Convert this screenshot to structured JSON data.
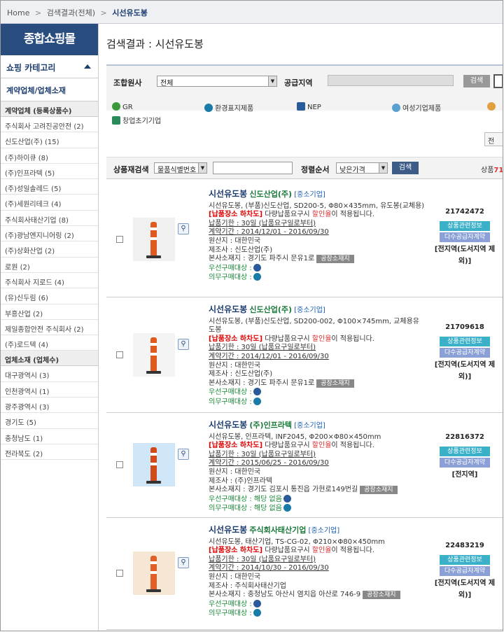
{
  "breadcrumb": {
    "home": "Home",
    "level1": "검색결과(전체)",
    "current": "시선유도봉",
    "sep": ">"
  },
  "sidebar": {
    "logo": "종합쇼핑몰",
    "category": "쇼핑 카테고리",
    "sub": "계약업체/업체소재",
    "section1": "계약업체 (등록상품수)",
    "companies": [
      "주식회사 고려진공안전 (2)",
      "신도산업(주) (15)",
      "(주)하이큐 (8)",
      "(주)인프라텍 (5)",
      "(주)성일솔레드 (5)",
      "(주)세원리테크 (4)",
      "주식회사태산기업 (8)",
      "(주)광남엔지니어링 (2)",
      "(주)상화산업 (2)",
      "로원 (2)",
      "주식회사 지로드 (4)",
      "(유)신두림 (6)",
      "부흥산업 (2)",
      "제일종합안전 주식회사 (2)",
      "(주)로드텍 (4)"
    ],
    "section2": "업체소재 (업체수)",
    "regions": [
      "대구광역시 (3)",
      "인천광역시 (1)",
      "광주광역시 (3)",
      "경기도 (5)",
      "충청남도 (1)",
      "전라북도 (2)"
    ]
  },
  "page_title": "검색결과 : 시선유도봉",
  "filter": {
    "org_label": "조합원사",
    "org_value": "전체",
    "region_label": "공급지역",
    "search_btn": "검색"
  },
  "certs": [
    "GR",
    "환경표지제품",
    "NEP",
    "여성기업제품",
    "창업초기기업"
  ],
  "page_btn": "전",
  "search_bar": {
    "label": "상품재검색",
    "type_value": "물품식별번호",
    "sort_label": "정렬순서",
    "sort_value": "낮은가격",
    "btn": "검색",
    "count_prefix": "상품",
    "count": "71"
  },
  "products": [
    {
      "name": "시선유도봉",
      "maker": "신도산업(주)",
      "tag": "[중소기업]",
      "desc": "시선유도봉, (부품)신도산업, SD200-5, Φ80×435mm, 유도봉(교체용)",
      "notice_red": "[납품장소 하차도]",
      "notice": " 다량납품요구시 ",
      "notice_hl": "할인율",
      "notice_end": "이 적용됩니다.",
      "delivery": "납품기한 : 30일 (납품요구일로부터)",
      "contract": "계약기간 : 2014/12/01 - 2016/09/30",
      "origin": "원산지 : 대한민국",
      "mfr": "제조사 : 신도산업(주)",
      "addr": "본사소재지 : 경기도 파주시 문유1로",
      "fac": "공장소재지",
      "pref": "우선구매대상 :",
      "mand": "의무구매대상 :",
      "pref_val": "",
      "mand_val": "",
      "code": "21742472",
      "b1": "상품관련정보",
      "b2": "다수공급자계약",
      "reg": "[전지역(도서지역 제외)]"
    },
    {
      "name": "시선유도봉",
      "maker": "신도산업(주)",
      "tag": "[중소기업]",
      "desc": "시선유도봉, (부품)신도산업, SD200-002, Φ100×745mm, 교체용유도봉",
      "notice_red": "[납품장소 하차도]",
      "notice": " 다량납품요구시 ",
      "notice_hl": "할인율",
      "notice_end": "이 적용됩니다.",
      "delivery": "납품기한 : 30일 (납품요구일로부터)",
      "contract": "계약기간 : 2014/12/01 - 2016/09/30",
      "origin": "원산지 : 대한민국",
      "mfr": "제조사 : 신도산업(주)",
      "addr": "본사소재지 : 경기도 파주시 문유1로",
      "fac": "공장소재지",
      "pref": "우선구매대상 :",
      "mand": "의무구매대상 :",
      "pref_val": "",
      "mand_val": "",
      "code": "21709618",
      "b1": "상품관련정보",
      "b2": "다수공급자계약",
      "reg": "[전지역(도서지역 제외)]"
    },
    {
      "name": "시선유도봉",
      "maker": "(주)인프라텍",
      "tag": "[중소기업]",
      "desc": "시선유도봉, 인프라텍, INF2045, Φ200×Φ80×450mm",
      "notice_red": "[납품장소 하차도]",
      "notice": " 다량납품요구시 ",
      "notice_hl": "할인율",
      "notice_end": "이 적용됩니다.",
      "delivery": "납품기한 : 30일 (납품요구일로부터)",
      "contract": "계약기간 : 2015/06/25 - 2016/09/30",
      "origin": "원산지 : 대한민국",
      "mfr": "제조사 : (주)인프라텍",
      "addr": "본사소재지 : 경기도 김포시 통진읍 가현로149번길",
      "fac": "공장소재지",
      "pref": "우선구매대상 :",
      "mand": "의무구매대상 :",
      "pref_val": " 해당 없음",
      "mand_val": " 해당 없음",
      "code": "22816372",
      "b1": "상품관련정보",
      "b2": "다수공급자계약",
      "reg": "[전지역]"
    },
    {
      "name": "시선유도봉",
      "maker": "주식회사태산기업",
      "tag": "[중소기업]",
      "desc": "시선유도봉, 태산기업, TS-CG-02, Φ210×Φ80×450mm",
      "notice_red": "[납품장소 하차도]",
      "notice": " 다량납품요구시 ",
      "notice_hl": "할인율",
      "notice_end": "이 적용됩니다.",
      "delivery": "납품기한 : 30일 (납품요구일로부터)",
      "contract": "계약기간 : 2014/10/30 - 2016/09/30",
      "origin": "원산지 : 대한민국",
      "mfr": "제조사 : 주식회사태산기업",
      "addr": "본사소재지 : 충청남도 아산시 염치읍 아산로 746-9",
      "fac": "공장소재지",
      "pref": "우선구매대상 :",
      "mand": "의무구매대상 :",
      "pref_val": "",
      "mand_val": "",
      "code": "22483219",
      "b1": "상품관련정보",
      "b2": "다수공급자계약",
      "reg": "[전지역(도서지역 제외)]"
    }
  ],
  "colors": {
    "brand": "#2a4d80",
    "green": "#1a8a3a",
    "red": "#dd0000",
    "cyan_btn": "#3bb0c9",
    "purple_btn": "#8aa0d6"
  }
}
